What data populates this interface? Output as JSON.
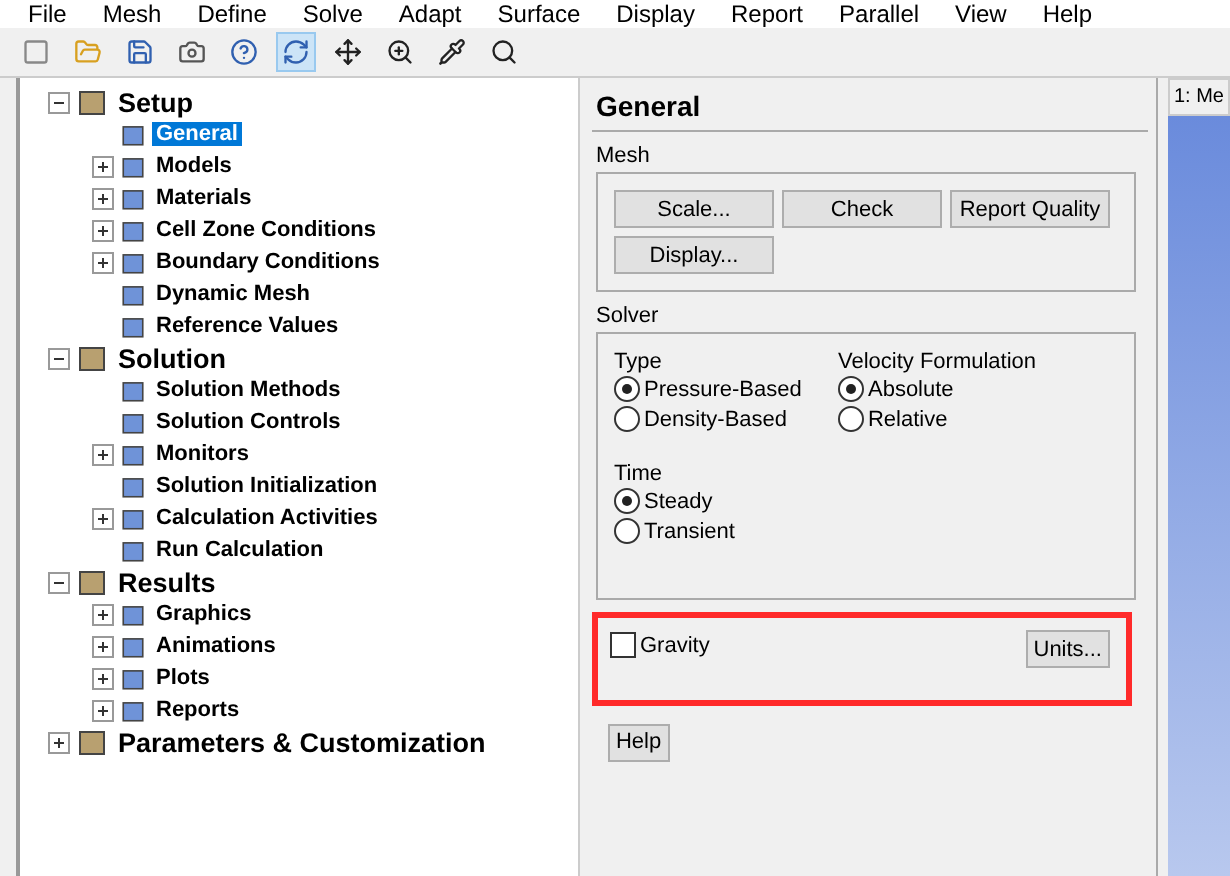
{
  "menu": [
    "File",
    "Mesh",
    "Define",
    "Solve",
    "Adapt",
    "Surface",
    "Display",
    "Report",
    "Parallel",
    "View",
    "Help"
  ],
  "tree": [
    {
      "label": "Setup",
      "kind": "branch",
      "expanded": true,
      "children": [
        {
          "label": "General",
          "kind": "leaf",
          "selected": true
        },
        {
          "label": "Models",
          "kind": "branch",
          "expanded": false,
          "selected": false
        },
        {
          "label": "Materials",
          "kind": "branch",
          "expanded": false,
          "selected": false
        },
        {
          "label": "Cell Zone Conditions",
          "kind": "branch",
          "expanded": false,
          "selected": false
        },
        {
          "label": "Boundary Conditions",
          "kind": "branch",
          "expanded": false,
          "selected": false
        },
        {
          "label": "Dynamic Mesh",
          "kind": "leaf",
          "selected": false
        },
        {
          "label": "Reference Values",
          "kind": "leaf",
          "selected": false
        }
      ]
    },
    {
      "label": "Solution",
      "kind": "branch",
      "expanded": true,
      "children": [
        {
          "label": "Solution Methods",
          "kind": "leaf",
          "selected": false
        },
        {
          "label": "Solution Controls",
          "kind": "leaf",
          "selected": false
        },
        {
          "label": "Monitors",
          "kind": "branch",
          "expanded": false,
          "selected": false
        },
        {
          "label": "Solution Initialization",
          "kind": "leaf",
          "selected": false
        },
        {
          "label": "Calculation Activities",
          "kind": "branch",
          "expanded": false,
          "selected": false
        },
        {
          "label": "Run Calculation",
          "kind": "leaf",
          "selected": false
        }
      ]
    },
    {
      "label": "Results",
      "kind": "branch",
      "expanded": true,
      "children": [
        {
          "label": "Graphics",
          "kind": "branch",
          "expanded": false,
          "selected": false
        },
        {
          "label": "Animations",
          "kind": "branch",
          "expanded": false,
          "selected": false
        },
        {
          "label": "Plots",
          "kind": "branch",
          "expanded": false,
          "selected": false
        },
        {
          "label": "Reports",
          "kind": "branch",
          "expanded": false,
          "selected": false
        }
      ]
    },
    {
      "label": "Parameters & Customization",
      "kind": "branch",
      "expanded": false
    }
  ],
  "panel": {
    "title": "General",
    "mesh": {
      "label": "Mesh",
      "buttons": [
        "Scale...",
        "Check",
        "Report Quality",
        "Display..."
      ]
    },
    "solver": {
      "label": "Solver",
      "groups": [
        {
          "label": "Type",
          "options": [
            {
              "label": "Pressure-Based",
              "selected": true
            },
            {
              "label": "Density-Based",
              "selected": false
            }
          ]
        },
        {
          "label": "Velocity Formulation",
          "options": [
            {
              "label": "Absolute",
              "selected": true
            },
            {
              "label": "Relative",
              "selected": false
            }
          ]
        },
        {
          "label": "Time",
          "options": [
            {
              "label": "Steady",
              "selected": true
            },
            {
              "label": "Transient",
              "selected": false
            }
          ]
        }
      ]
    },
    "gravity": {
      "label": "Gravity",
      "checked": false,
      "highlighted": true
    },
    "units_button": "Units...",
    "help_button": "Help"
  },
  "graphics": {
    "tab": "1: Me"
  }
}
